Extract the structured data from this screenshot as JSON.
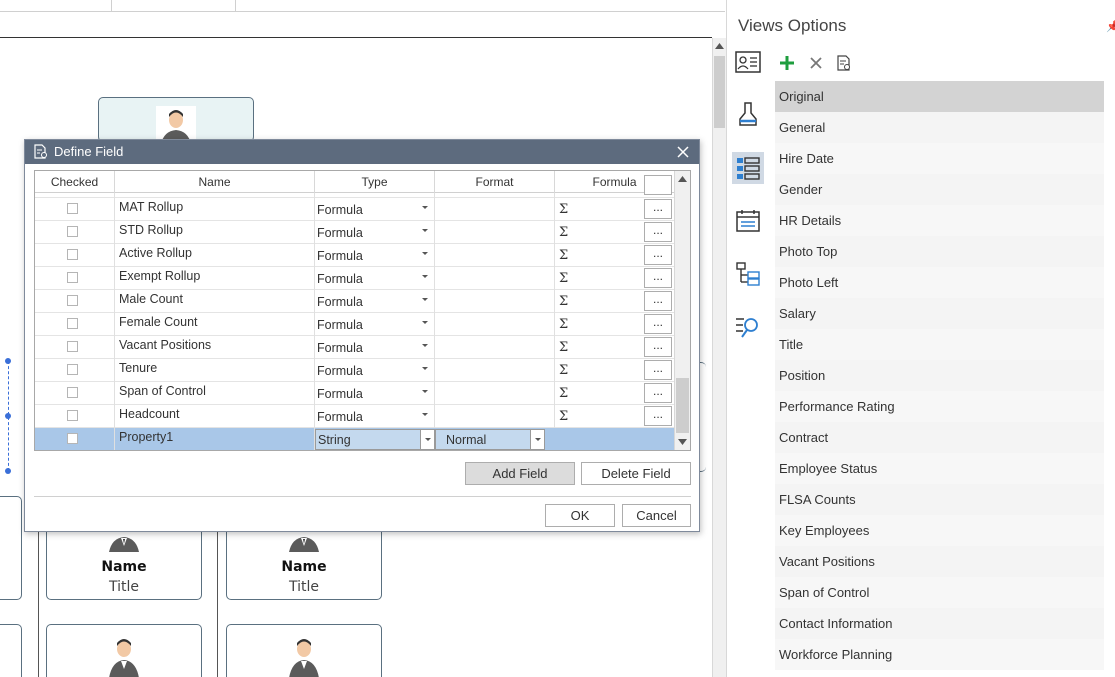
{
  "canvas": {
    "cards": [
      {
        "name": "Name",
        "title": "Title"
      },
      {
        "name": "Name",
        "title": "Title"
      }
    ]
  },
  "views_options": {
    "title": "Views Options",
    "sidebar_icons": [
      "contact-card-icon",
      "paint-brush-icon",
      "field-list-icon",
      "calendar-list-icon",
      "hierarchy-icon",
      "search-list-icon"
    ],
    "toolbar": {
      "add_icon": "plus-icon",
      "delete_icon": "close-icon",
      "properties_icon": "document-settings-icon"
    },
    "items": [
      "Original",
      "General",
      "Hire Date",
      "Gender",
      "HR Details",
      "Photo Top",
      "Photo Left",
      "Salary",
      "Title",
      "Position",
      "Performance Rating",
      "Contract",
      "Employee Status",
      "FLSA Counts",
      "Key Employees",
      "Vacant Positions",
      "Span of Control",
      "Contact Information",
      "Workforce Planning"
    ],
    "selected": "Original"
  },
  "dialog": {
    "title": "Define Field",
    "columns": {
      "checked": "Checked",
      "name": "Name",
      "type": "Type",
      "format": "Format",
      "formula": "Formula"
    },
    "rows": [
      {
        "name": "MAT Rollup",
        "type": "Formula",
        "formula_symbol": "Σ",
        "button": "..."
      },
      {
        "name": "STD Rollup",
        "type": "Formula",
        "formula_symbol": "Σ",
        "button": "..."
      },
      {
        "name": "Active Rollup",
        "type": "Formula",
        "formula_symbol": "Σ",
        "button": "..."
      },
      {
        "name": "Exempt Rollup",
        "type": "Formula",
        "formula_symbol": "Σ",
        "button": "..."
      },
      {
        "name": "Male Count",
        "type": "Formula",
        "formula_symbol": "Σ",
        "button": "..."
      },
      {
        "name": "Female Count",
        "type": "Formula",
        "formula_symbol": "Σ",
        "button": "..."
      },
      {
        "name": "Vacant Positions",
        "type": "Formula",
        "formula_symbol": "Σ",
        "button": "..."
      },
      {
        "name": "Tenure",
        "type": "Formula",
        "formula_symbol": "Σ",
        "button": "..."
      },
      {
        "name": "Span of Control",
        "type": "Formula",
        "formula_symbol": "Σ",
        "button": "..."
      },
      {
        "name": "Headcount",
        "type": "Formula",
        "formula_symbol": "Σ",
        "button": "..."
      }
    ],
    "new_row": {
      "name": "Property1",
      "type": "String",
      "format": "Normal"
    },
    "add_field": "Add Field",
    "delete_field": "Delete Field",
    "ok": "OK",
    "cancel": "Cancel"
  },
  "colors": {
    "dialog_header": "#5d6b7e",
    "selected_row": "#a9c7e8",
    "accent_green": "#1e9e3e"
  }
}
